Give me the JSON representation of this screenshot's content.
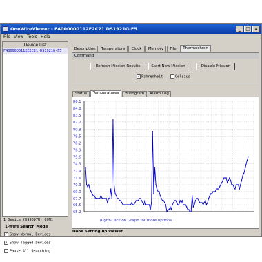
{
  "window": {
    "title": "OneWireViewer - F4000000112E2C21 DS1921G-F5",
    "close_glyph": "×",
    "max_glyph": "□",
    "min_glyph": "_"
  },
  "menu": [
    "File",
    "View",
    "Tools",
    "Help"
  ],
  "device_list": {
    "header": "Device List",
    "items": [
      "F4000000112E2C21 DS1921G-F5"
    ]
  },
  "bottom_left": {
    "device_count": "1 Device  (DS9097U) COM1",
    "search_mode": "1-Wire Search Mode",
    "options": [
      {
        "label": "Show Normal Devices",
        "checked": true
      },
      {
        "label": "Show Tagged Devices",
        "checked": true
      },
      {
        "label": "Pause All Searching",
        "checked": false
      }
    ]
  },
  "tabs": [
    "Description",
    "Temperature",
    "Clock",
    "Memory",
    "File",
    "Thermochron"
  ],
  "active_tab": "Thermochron",
  "command": {
    "title": "Command",
    "buttons": [
      "Refresh Mission Results",
      "Start New Mission",
      "Disable Mission"
    ],
    "units": [
      {
        "label": "Fahrenheit",
        "checked": true
      },
      {
        "label": "Celsius",
        "checked": false
      }
    ]
  },
  "subtabs": [
    "Status",
    "Temperatures",
    "Histogram",
    "Alarm Log"
  ],
  "active_subtab": "Temperatures",
  "graph_caption": "Right-Click on Graph for more options",
  "status_text": "Done Setting up viewer",
  "colors": {
    "accent": "#0a3ea8",
    "line": "#0000cc",
    "ylabel": "#3030c0"
  },
  "chart_data": {
    "type": "line",
    "title": "",
    "xlabel": "",
    "ylabel": "",
    "y_ticks": [
      65.2,
      66.5,
      67.7,
      69.0,
      70.3,
      71.6,
      72.9,
      74.3,
      75.6,
      76.9,
      78.2,
      79.5,
      80.8,
      82.2,
      83.5,
      84.8,
      86.1
    ],
    "ylim": [
      65.2,
      86.1
    ],
    "grid": true,
    "series": [
      {
        "values": [
          73.6,
          70.3,
          69.9,
          70.3,
          69.5,
          69.0,
          68.6,
          68.2,
          68.2,
          67.8,
          67.7,
          67.7,
          67.7,
          67.7,
          68.2,
          67.8,
          67.7,
          67.7,
          67.7,
          67.7,
          66.9,
          67.7,
          67.7,
          69.5,
          67.7,
          82.6,
          70.3,
          68.6,
          68.2,
          67.7,
          67.7,
          67.3,
          67.3,
          66.9,
          66.5,
          66.5,
          66.5,
          66.5,
          66.5,
          66.5,
          66.5,
          66.5,
          66.9,
          66.5,
          66.5,
          66.9,
          67.3,
          67.3,
          67.3,
          67.7,
          67.7,
          67.3,
          66.9,
          66.5,
          67.3,
          66.5,
          66.5,
          66.5,
          66.5,
          65.6,
          66.9,
          80.4,
          68.6,
          73.6,
          70.3,
          69.5,
          69.0,
          69.0,
          68.2,
          67.7,
          67.3,
          67.3,
          66.9,
          66.5,
          65.2,
          65.6,
          65.6,
          66.1,
          65.6,
          66.5,
          66.9,
          67.3,
          67.3,
          66.9,
          66.5,
          66.5,
          67.3,
          66.9,
          67.3,
          66.5,
          66.5,
          66.5,
          66.1,
          65.6,
          65.6,
          65.2,
          65.2,
          68.2,
          66.1,
          66.5,
          67.3,
          67.7,
          67.7,
          67.3,
          66.9,
          66.9,
          66.9,
          66.5,
          66.9,
          67.3,
          66.5,
          66.9,
          67.7,
          68.2,
          68.6,
          68.6,
          69.0,
          69.0,
          69.0,
          69.5,
          69.5,
          69.5,
          69.9,
          70.3,
          70.7,
          71.1,
          71.6,
          71.6,
          71.6,
          70.7,
          71.1,
          71.6,
          71.1,
          70.3,
          70.3,
          69.9,
          69.5,
          70.3,
          70.3,
          70.3,
          69.5,
          70.3,
          71.1,
          72.0,
          72.4,
          73.2,
          74.1,
          74.9,
          75.6
        ]
      }
    ]
  }
}
